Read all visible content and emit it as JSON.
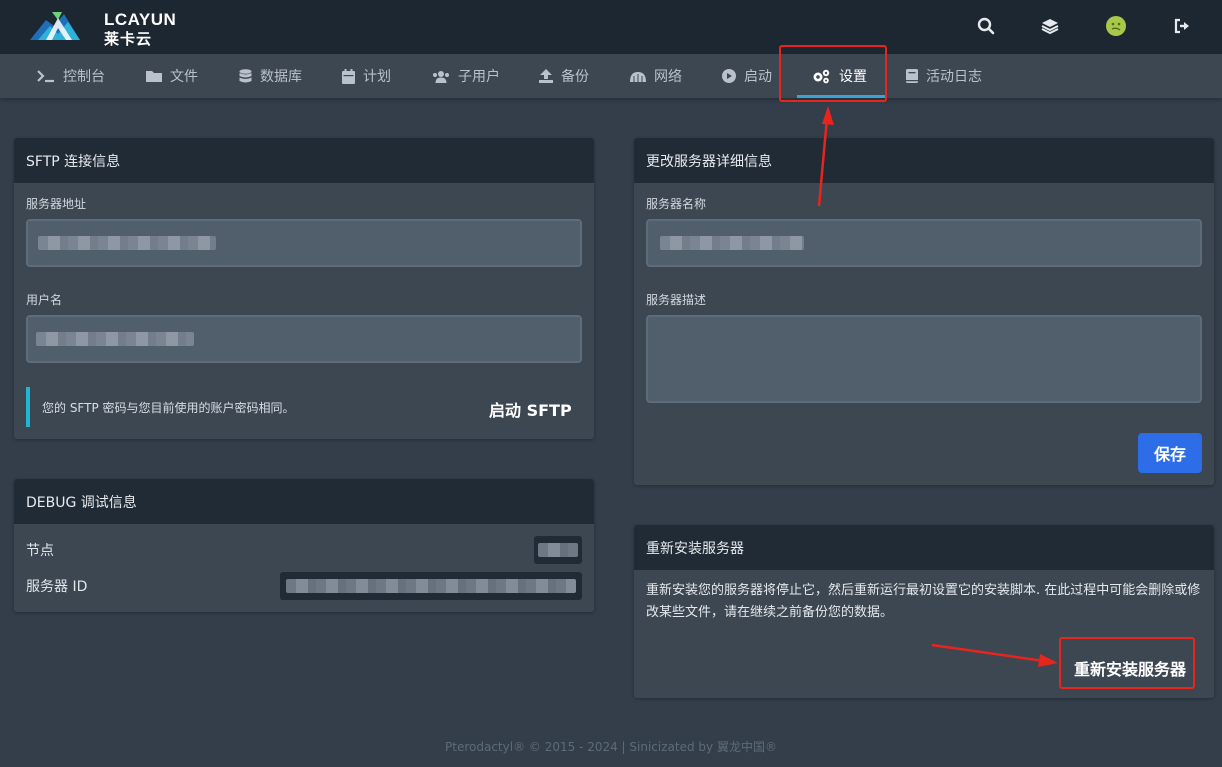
{
  "brand": {
    "name": "LCAYUN",
    "subtitle": "莱卡云"
  },
  "topbar": {
    "icons": [
      "search-icon",
      "layers-icon",
      "avatar",
      "sign-out-icon"
    ]
  },
  "nav": {
    "items": [
      {
        "label": "控制台",
        "icon": "terminal-icon"
      },
      {
        "label": "文件",
        "icon": "folder-icon"
      },
      {
        "label": "数据库",
        "icon": "database-icon"
      },
      {
        "label": "计划",
        "icon": "calendar-icon"
      },
      {
        "label": "子用户",
        "icon": "users-icon"
      },
      {
        "label": "备份",
        "icon": "upload-icon"
      },
      {
        "label": "网络",
        "icon": "network-icon"
      },
      {
        "label": "启动",
        "icon": "play-icon"
      },
      {
        "label": "设置",
        "icon": "cogs-icon"
      },
      {
        "label": "活动日志",
        "icon": "book-icon"
      }
    ],
    "active": "设置"
  },
  "sftp": {
    "title": "SFTP 连接信息",
    "address_label": "服务器地址",
    "username_label": "用户名",
    "note": "您的 SFTP 密码与您目前使用的账户密码相同。",
    "launch_label": "启动 SFTP"
  },
  "debug": {
    "title": "DEBUG 调试信息",
    "node_label": "节点",
    "server_id_label": "服务器 ID"
  },
  "details": {
    "title": "更改服务器详细信息",
    "name_label": "服务器名称",
    "description_label": "服务器描述",
    "save_label": "保存"
  },
  "reinstall": {
    "title": "重新安装服务器",
    "description": "重新安装您的服务器将停止它，然后重新运行最初设置它的安装脚本. 在此过程中可能会删除或修改某些文件，请在继续之前备份您的数据。",
    "button_label": "重新安装服务器"
  },
  "footer": {
    "text": "Pterodactyl® © 2015 - 2024 | Sinicizated by 翼龙中国®"
  },
  "colors": {
    "accent": "#3aa3d6",
    "save_button": "#2d6ee8",
    "annotation": "#e8251c",
    "note_border": "#1fb7d3"
  }
}
